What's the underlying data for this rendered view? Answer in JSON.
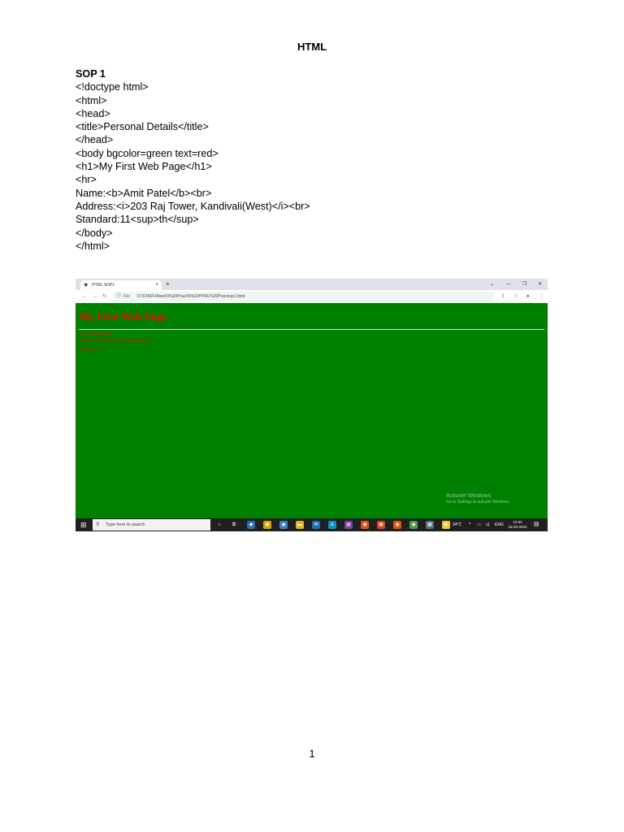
{
  "document": {
    "title": "HTML",
    "section_heading": "SOP 1",
    "code_lines": [
      "<!doctype html>",
      "<html>",
      "<head>",
      "<title>Personal Details</title>",
      "</head>",
      "<body bgcolor=green text=red>",
      "<h1>My First Web Page</h1>",
      "<hr>",
      "Name:<b>Amit Patel</b><br>",
      "Address:<i>203 Raj Tower, Kandivali(West)</i><br>",
      "Standard:11<sup>th</sup>",
      "</body>",
      "</html>"
    ],
    "page_number": "1"
  },
  "browser": {
    "tab_title": "HTML SOP1",
    "tab_close": "×",
    "new_tab": "+",
    "file_label": "File",
    "url": "D:/STAFF/Aive/XI%20Prac/XI%20HTML%20Prac/sop1.html",
    "rendered": {
      "heading": "My First Web Page",
      "name_label": "Name:",
      "name_value": "Amit Patel",
      "address_label": "Address:",
      "address_value": "203 Raj Tower, Kandivali(West)",
      "standard_label": "Standard:11",
      "standard_sup": "th",
      "background_color": "#008000",
      "text_color": "#ff0000"
    },
    "watermark_line1": "Activate Windows",
    "watermark_line2": "Go to Settings to activate Windows."
  },
  "taskbar": {
    "search_placeholder": "Type here to search",
    "weather": "34°C",
    "language": "ENG",
    "time": "10:42",
    "date": "16-03-2022"
  }
}
